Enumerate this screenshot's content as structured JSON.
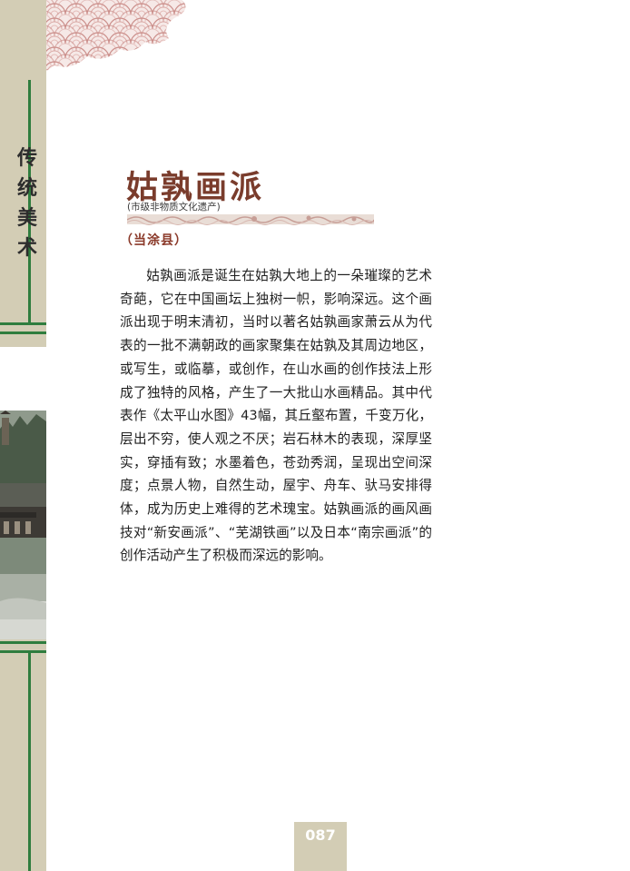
{
  "section": {
    "title": "传统美术"
  },
  "article": {
    "title": "姑孰画派",
    "subtitle": "(市级非物质文化遗产)",
    "location": "（当涂县）",
    "body": "姑孰画派是诞生在姑孰大地上的一朵璀璨的艺术奇葩，它在中国画坛上独树一帜，影响深远。这个画派出现于明末清初，当时以著名姑孰画家萧云从为代表的一批不满朝政的画家聚集在姑孰及其周边地区，或写生，或临摹，或创作，在山水画的创作技法上形成了独特的风格，产生了一大批山水画精品。其中代表作《太平山水图》43幅，其丘壑布置，千变万化，层出不穷，使人观之不厌；岩石林木的表现，深厚坚实，穿插有致；水墨着色，苍劲秀润，呈现出空间深度；点景人物，自然生动，屋宇、舟车、驮马安排得体，成为历史上难得的艺术瑰宝。姑孰画派的画风画技对“新安画派”、“芜湖铁画”以及日本“南宗画派”的创作活动产生了积极而深远的影响。"
  },
  "page": {
    "number": "087"
  },
  "colors": {
    "band": "#d3cdb5",
    "green": "#2f7d3e",
    "title": "#7a3c2c",
    "location": "#8b3a2a",
    "clouds": "#c98a86"
  }
}
